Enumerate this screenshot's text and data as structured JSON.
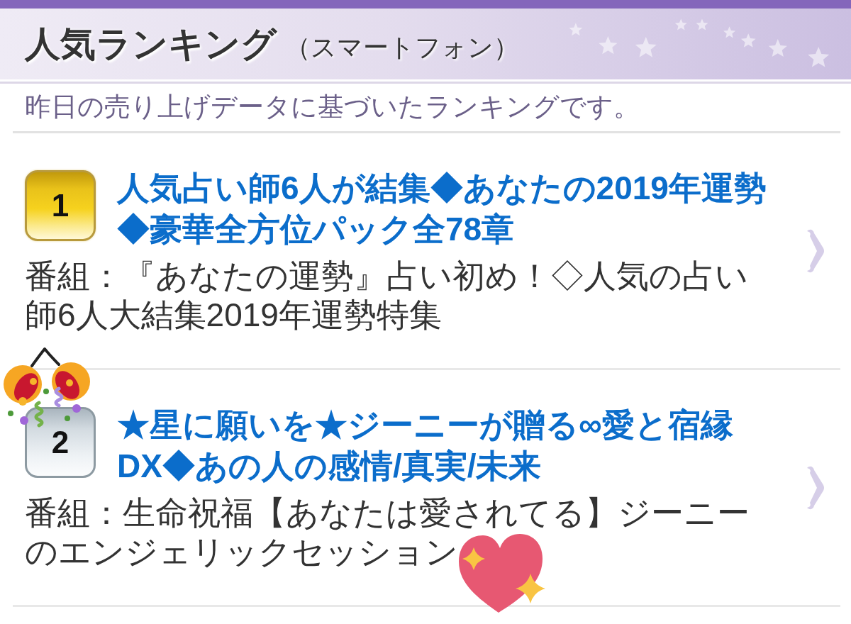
{
  "header": {
    "title": "人気ランキング",
    "subtitle": "（スマートフォン）"
  },
  "intro": "昨日の売り上げデータに基づいたランキングです。",
  "rankings": [
    {
      "rank": "1",
      "kind": "gold",
      "title": "人気占い師6人が結集◆あなたの2019年運勢◆豪華全方位パック全78章",
      "program": "番組：『あなたの運勢』占い初め！◇人気の占い師6人大結集2019年運勢特集"
    },
    {
      "rank": "2",
      "kind": "silver",
      "title": "★星に願いを★ジーニーが贈る∞愛と宿縁DX◆あの人の感情/真実/未来",
      "program": "番組：生命祝福【あなたは愛されてる】ジーニーのエンジェリックセッション"
    }
  ]
}
